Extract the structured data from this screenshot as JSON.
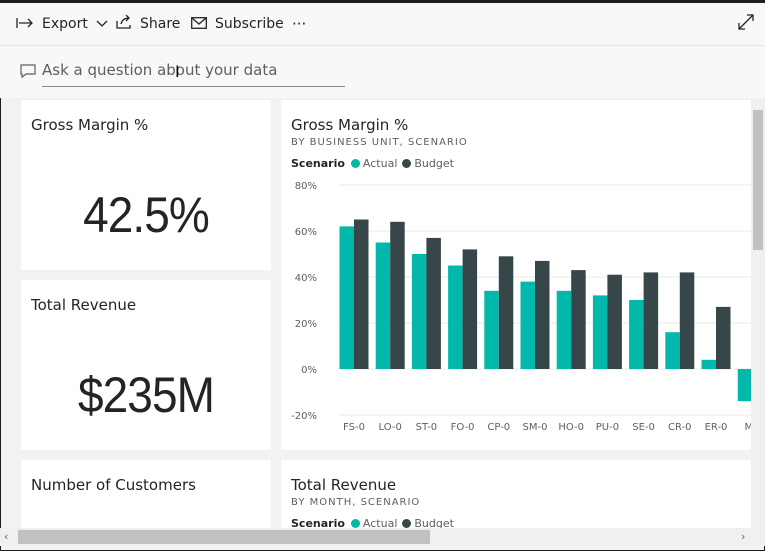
{
  "toolbar": {
    "export_label": "Export",
    "share_label": "Share",
    "subscribe_label": "Subscribe",
    "more_label": "···"
  },
  "qa": {
    "placeholder": "Ask a question about your data"
  },
  "tiles": {
    "gross_margin": {
      "title": "Gross Margin %",
      "value": "42.5%"
    },
    "total_revenue": {
      "title": "Total Revenue",
      "value": "$235M"
    },
    "customers": {
      "title": "Number of Customers"
    },
    "bar_chart": {
      "title": "Gross Margin %",
      "subtitle": "BY BUSINESS UNIT, SCENARIO",
      "legend_title": "Scenario",
      "legend_actual": "Actual",
      "legend_budget": "Budget"
    },
    "revenue_month": {
      "title": "Total Revenue",
      "subtitle": "BY MONTH, SCENARIO",
      "legend_title": "Scenario",
      "legend_actual": "Actual",
      "legend_budget": "Budget"
    }
  },
  "colors": {
    "actual": "#01b8aa",
    "budget": "#374649"
  },
  "chart_data": {
    "type": "bar",
    "title": "Gross Margin %",
    "subtitle": "BY BUSINESS UNIT, SCENARIO",
    "categories": [
      "FS-0",
      "LO-0",
      "ST-0",
      "FO-0",
      "CP-0",
      "SM-0",
      "HO-0",
      "PU-0",
      "SE-0",
      "CR-0",
      "ER-0",
      "MA"
    ],
    "series": [
      {
        "name": "Actual",
        "values": [
          62,
          55,
          50,
          45,
          34,
          38,
          34,
          32,
          30,
          16,
          4,
          -14
        ]
      },
      {
        "name": "Budget",
        "values": [
          65,
          64,
          57,
          52,
          49,
          47,
          43,
          41,
          42,
          42,
          27,
          null
        ]
      }
    ],
    "yticks": [
      "80%",
      "60%",
      "40%",
      "20%",
      "0%",
      "-20%"
    ],
    "ylim": [
      -20,
      80
    ],
    "legend_title": "Scenario",
    "grid": true,
    "legend": "top-left"
  }
}
